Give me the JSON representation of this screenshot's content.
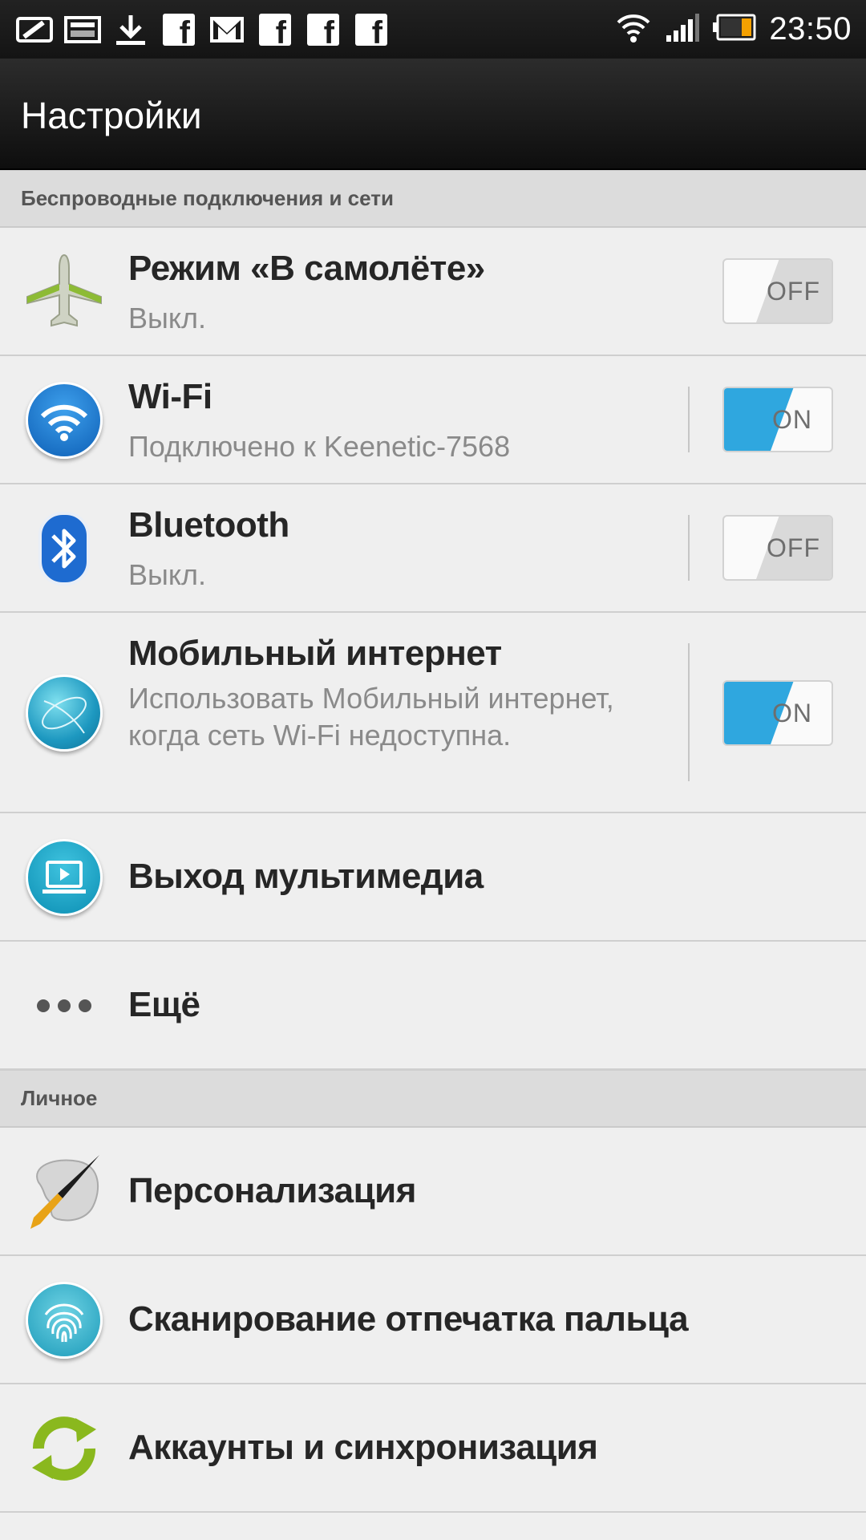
{
  "status_bar": {
    "time": "23:50",
    "left_icons": [
      "tablet-notification-icon",
      "gallery-icon",
      "download-icon",
      "facebook-icon",
      "gmail-icon",
      "facebook-icon",
      "facebook-icon",
      "facebook-icon"
    ],
    "right_icons": [
      "wifi-signal-icon",
      "cell-signal-icon",
      "battery-icon"
    ],
    "facebook_glyph": "f"
  },
  "action_bar": {
    "title": "Настройки"
  },
  "sections": {
    "wireless": "Беспроводные подключения и сети",
    "personal": "Личное"
  },
  "items": {
    "airplane": {
      "title": "Режим «В самолёте»",
      "subtitle": "Выкл.",
      "toggle": "OFF",
      "icon": "airplane-icon"
    },
    "wifi": {
      "title": "Wi-Fi",
      "subtitle": "Подключено к Keenetic-7568",
      "toggle": "ON",
      "icon": "wifi-icon"
    },
    "bluetooth": {
      "title": "Bluetooth",
      "subtitle": "Выкл.",
      "toggle": "OFF",
      "icon": "bluetooth-icon"
    },
    "mobile": {
      "title": "Мобильный интернет",
      "subtitle": "Использовать Мобильный интернет, когда сеть Wi-Fi недоступна.",
      "toggle": "ON",
      "icon": "globe-icon"
    },
    "media": {
      "title": "Выход мультимедиа",
      "icon": "media-output-icon"
    },
    "more": {
      "title": "Ещё",
      "icon": "more-dots-icon"
    },
    "personalization": {
      "title": "Персонализация",
      "icon": "paintbrush-icon"
    },
    "fingerprint": {
      "title": "Сканирование отпечатка пальца",
      "icon": "fingerprint-icon"
    },
    "accounts": {
      "title": "Аккаунты и синхронизация",
      "icon": "sync-icon"
    }
  },
  "colors": {
    "toggle_on": "#2fa7df",
    "background": "#efefef",
    "section_bg": "#dcdcdc",
    "sync_green": "#8ab81e"
  }
}
